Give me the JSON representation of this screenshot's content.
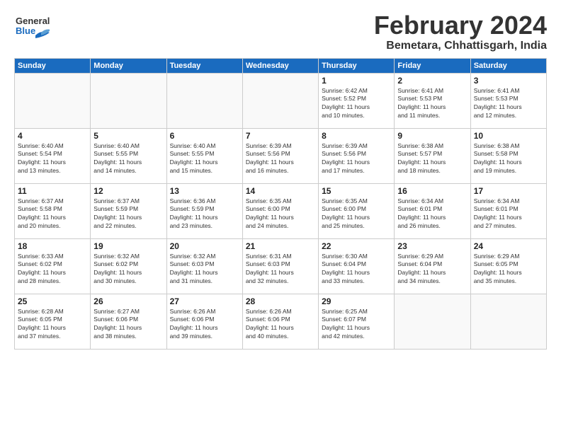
{
  "header": {
    "logo_line1": "General",
    "logo_line2": "Blue",
    "title": "February 2024",
    "subtitle": "Bemetara, Chhattisgarh, India"
  },
  "weekdays": [
    "Sunday",
    "Monday",
    "Tuesday",
    "Wednesday",
    "Thursday",
    "Friday",
    "Saturday"
  ],
  "weeks": [
    [
      {
        "day": "",
        "info": ""
      },
      {
        "day": "",
        "info": ""
      },
      {
        "day": "",
        "info": ""
      },
      {
        "day": "",
        "info": ""
      },
      {
        "day": "1",
        "info": "Sunrise: 6:42 AM\nSunset: 5:52 PM\nDaylight: 11 hours\nand 10 minutes."
      },
      {
        "day": "2",
        "info": "Sunrise: 6:41 AM\nSunset: 5:53 PM\nDaylight: 11 hours\nand 11 minutes."
      },
      {
        "day": "3",
        "info": "Sunrise: 6:41 AM\nSunset: 5:53 PM\nDaylight: 11 hours\nand 12 minutes."
      }
    ],
    [
      {
        "day": "4",
        "info": "Sunrise: 6:40 AM\nSunset: 5:54 PM\nDaylight: 11 hours\nand 13 minutes."
      },
      {
        "day": "5",
        "info": "Sunrise: 6:40 AM\nSunset: 5:55 PM\nDaylight: 11 hours\nand 14 minutes."
      },
      {
        "day": "6",
        "info": "Sunrise: 6:40 AM\nSunset: 5:55 PM\nDaylight: 11 hours\nand 15 minutes."
      },
      {
        "day": "7",
        "info": "Sunrise: 6:39 AM\nSunset: 5:56 PM\nDaylight: 11 hours\nand 16 minutes."
      },
      {
        "day": "8",
        "info": "Sunrise: 6:39 AM\nSunset: 5:56 PM\nDaylight: 11 hours\nand 17 minutes."
      },
      {
        "day": "9",
        "info": "Sunrise: 6:38 AM\nSunset: 5:57 PM\nDaylight: 11 hours\nand 18 minutes."
      },
      {
        "day": "10",
        "info": "Sunrise: 6:38 AM\nSunset: 5:58 PM\nDaylight: 11 hours\nand 19 minutes."
      }
    ],
    [
      {
        "day": "11",
        "info": "Sunrise: 6:37 AM\nSunset: 5:58 PM\nDaylight: 11 hours\nand 20 minutes."
      },
      {
        "day": "12",
        "info": "Sunrise: 6:37 AM\nSunset: 5:59 PM\nDaylight: 11 hours\nand 22 minutes."
      },
      {
        "day": "13",
        "info": "Sunrise: 6:36 AM\nSunset: 5:59 PM\nDaylight: 11 hours\nand 23 minutes."
      },
      {
        "day": "14",
        "info": "Sunrise: 6:35 AM\nSunset: 6:00 PM\nDaylight: 11 hours\nand 24 minutes."
      },
      {
        "day": "15",
        "info": "Sunrise: 6:35 AM\nSunset: 6:00 PM\nDaylight: 11 hours\nand 25 minutes."
      },
      {
        "day": "16",
        "info": "Sunrise: 6:34 AM\nSunset: 6:01 PM\nDaylight: 11 hours\nand 26 minutes."
      },
      {
        "day": "17",
        "info": "Sunrise: 6:34 AM\nSunset: 6:01 PM\nDaylight: 11 hours\nand 27 minutes."
      }
    ],
    [
      {
        "day": "18",
        "info": "Sunrise: 6:33 AM\nSunset: 6:02 PM\nDaylight: 11 hours\nand 28 minutes."
      },
      {
        "day": "19",
        "info": "Sunrise: 6:32 AM\nSunset: 6:02 PM\nDaylight: 11 hours\nand 30 minutes."
      },
      {
        "day": "20",
        "info": "Sunrise: 6:32 AM\nSunset: 6:03 PM\nDaylight: 11 hours\nand 31 minutes."
      },
      {
        "day": "21",
        "info": "Sunrise: 6:31 AM\nSunset: 6:03 PM\nDaylight: 11 hours\nand 32 minutes."
      },
      {
        "day": "22",
        "info": "Sunrise: 6:30 AM\nSunset: 6:04 PM\nDaylight: 11 hours\nand 33 minutes."
      },
      {
        "day": "23",
        "info": "Sunrise: 6:29 AM\nSunset: 6:04 PM\nDaylight: 11 hours\nand 34 minutes."
      },
      {
        "day": "24",
        "info": "Sunrise: 6:29 AM\nSunset: 6:05 PM\nDaylight: 11 hours\nand 35 minutes."
      }
    ],
    [
      {
        "day": "25",
        "info": "Sunrise: 6:28 AM\nSunset: 6:05 PM\nDaylight: 11 hours\nand 37 minutes."
      },
      {
        "day": "26",
        "info": "Sunrise: 6:27 AM\nSunset: 6:06 PM\nDaylight: 11 hours\nand 38 minutes."
      },
      {
        "day": "27",
        "info": "Sunrise: 6:26 AM\nSunset: 6:06 PM\nDaylight: 11 hours\nand 39 minutes."
      },
      {
        "day": "28",
        "info": "Sunrise: 6:26 AM\nSunset: 6:06 PM\nDaylight: 11 hours\nand 40 minutes."
      },
      {
        "day": "29",
        "info": "Sunrise: 6:25 AM\nSunset: 6:07 PM\nDaylight: 11 hours\nand 42 minutes."
      },
      {
        "day": "",
        "info": ""
      },
      {
        "day": "",
        "info": ""
      }
    ]
  ]
}
